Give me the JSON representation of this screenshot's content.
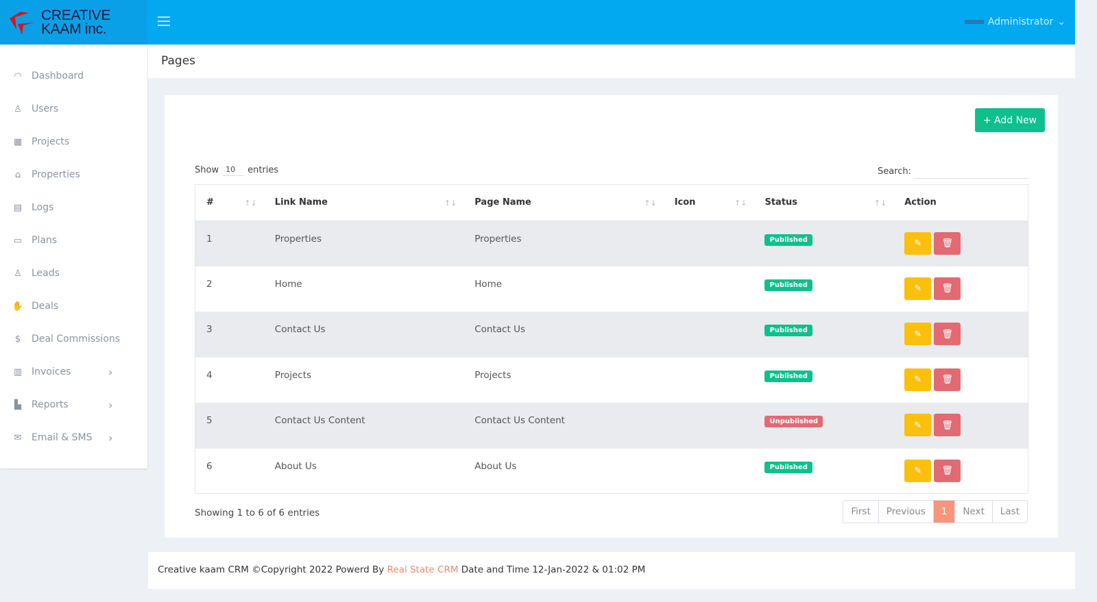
{
  "brand": {
    "line1": "CREATIVE",
    "line2": "KAAM inc."
  },
  "header": {
    "user": "Administrator",
    "title": "Pages"
  },
  "sidebar": {
    "items": [
      {
        "label": "Dashboard",
        "icon": "dashboard-icon"
      },
      {
        "label": "Users",
        "icon": "user-icon"
      },
      {
        "label": "Projects",
        "icon": "grid-icon"
      },
      {
        "label": "Properties",
        "icon": "home-icon"
      },
      {
        "label": "Logs",
        "icon": "log-icon"
      },
      {
        "label": "Plans",
        "icon": "briefcase-icon"
      },
      {
        "label": "Leads",
        "icon": "user-icon"
      },
      {
        "label": "Deals",
        "icon": "handshake-icon"
      },
      {
        "label": "Deal Commissions",
        "icon": "dollar-icon"
      },
      {
        "label": "Invoices",
        "icon": "invoice-icon"
      },
      {
        "label": "Reports",
        "icon": "chart-icon"
      },
      {
        "label": "Email & SMS",
        "icon": "mail-icon"
      }
    ]
  },
  "card": {
    "add_label": "+ Add New",
    "show": "Show",
    "length": "10",
    "entries": "entries",
    "search_label": "Search:"
  },
  "table": {
    "headers": [
      "#",
      "Link Name",
      "Page Name",
      "Icon",
      "Status",
      "Action"
    ],
    "rows": [
      {
        "n": "1",
        "link": "Properties",
        "page": "Properties",
        "icon": "",
        "status": "Published"
      },
      {
        "n": "2",
        "link": "Home",
        "page": "Home",
        "icon": "",
        "status": "Published"
      },
      {
        "n": "3",
        "link": "Contact Us",
        "page": "Contact Us",
        "icon": "",
        "status": "Published"
      },
      {
        "n": "4",
        "link": "Projects",
        "page": "Projects",
        "icon": "",
        "status": "Published"
      },
      {
        "n": "5",
        "link": "Contact Us Content",
        "page": "Contact Us Content",
        "icon": "",
        "status": "Unpublished"
      },
      {
        "n": "6",
        "link": "About Us",
        "page": "About Us",
        "icon": "",
        "status": "Published"
      }
    ]
  },
  "info": "Showing 1 to 6 of 6 entries",
  "pager": [
    "First",
    "Previous",
    "1",
    "Next",
    "Last"
  ],
  "footer": {
    "pre": "Creative kaam CRM ©Copyright 2022 Powerd By ",
    "link": "Real State CRM",
    "post": " Date and Time 12-Jan-2022 & 01:02 PM"
  }
}
